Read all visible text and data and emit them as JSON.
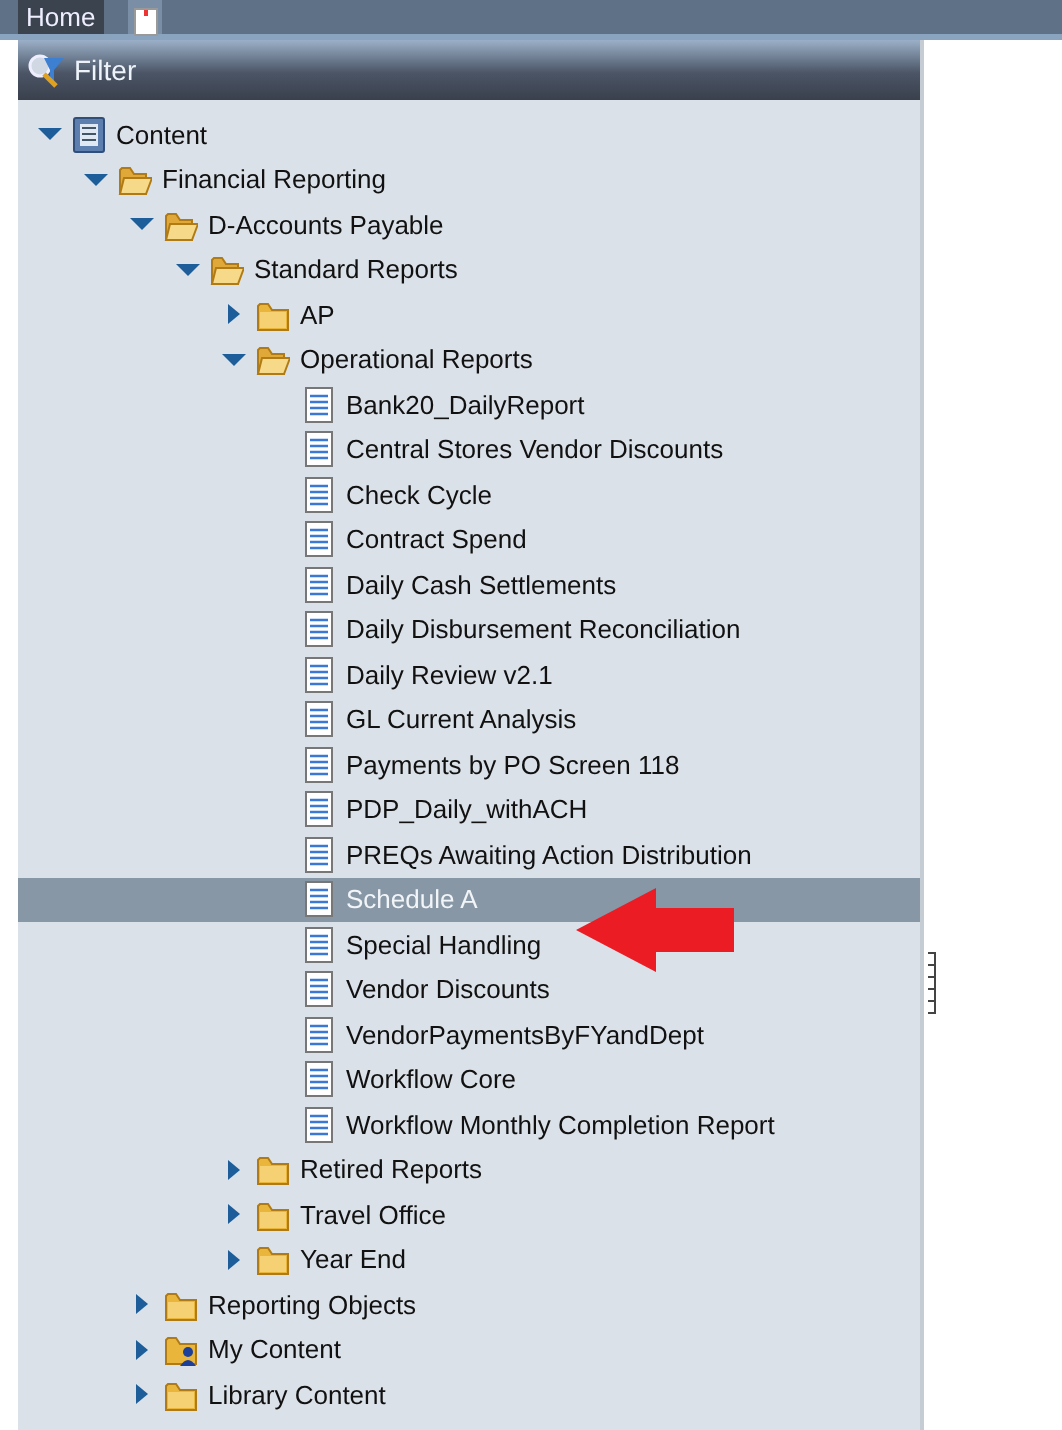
{
  "tabs": [
    {
      "label": "Home",
      "kind": "text",
      "selected": true
    },
    {
      "kind": "document",
      "selected": false
    }
  ],
  "panel": {
    "title": "Filter"
  },
  "tree": [
    {
      "label": "Content",
      "kind": "root",
      "expanded": true,
      "selected": false,
      "children": [
        {
          "label": "Financial Reporting",
          "kind": "folder",
          "expanded": true,
          "selected": false,
          "children": [
            {
              "label": "D-Accounts Payable",
              "kind": "folder",
              "expanded": true,
              "selected": false,
              "children": [
                {
                  "label": "Standard Reports",
                  "kind": "folder",
                  "expanded": true,
                  "selected": false,
                  "children": [
                    {
                      "label": "AP",
                      "kind": "folder",
                      "expanded": false,
                      "selected": false
                    },
                    {
                      "label": "Operational Reports",
                      "kind": "folder",
                      "expanded": true,
                      "selected": false,
                      "children": [
                        {
                          "label": "Bank20_DailyReport",
                          "kind": "report",
                          "selected": false
                        },
                        {
                          "label": "Central Stores Vendor Discounts",
                          "kind": "report",
                          "selected": false
                        },
                        {
                          "label": "Check Cycle",
                          "kind": "report",
                          "selected": false
                        },
                        {
                          "label": "Contract Spend",
                          "kind": "report",
                          "selected": false
                        },
                        {
                          "label": "Daily Cash Settlements",
                          "kind": "report",
                          "selected": false
                        },
                        {
                          "label": "Daily Disbursement Reconciliation",
                          "kind": "report",
                          "selected": false
                        },
                        {
                          "label": "Daily Review v2.1",
                          "kind": "report",
                          "selected": false
                        },
                        {
                          "label": "GL Current Analysis",
                          "kind": "report",
                          "selected": false
                        },
                        {
                          "label": "Payments by PO Screen 118",
                          "kind": "report",
                          "selected": false
                        },
                        {
                          "label": "PDP_Daily_withACH",
                          "kind": "report",
                          "selected": false
                        },
                        {
                          "label": "PREQs Awaiting Action Distribution",
                          "kind": "report",
                          "selected": false
                        },
                        {
                          "label": "Schedule A",
                          "kind": "report",
                          "selected": true
                        },
                        {
                          "label": "Special Handling",
                          "kind": "report",
                          "selected": false
                        },
                        {
                          "label": "Vendor Discounts",
                          "kind": "report",
                          "selected": false
                        },
                        {
                          "label": "VendorPaymentsByFYandDept",
                          "kind": "report",
                          "selected": false
                        },
                        {
                          "label": "Workflow Core",
                          "kind": "report",
                          "selected": false
                        },
                        {
                          "label": "Workflow Monthly Completion Report",
                          "kind": "report",
                          "selected": false
                        }
                      ]
                    },
                    {
                      "label": "Retired Reports",
                      "kind": "folder",
                      "expanded": false,
                      "selected": false
                    },
                    {
                      "label": "Travel Office",
                      "kind": "folder",
                      "expanded": false,
                      "selected": false
                    },
                    {
                      "label": "Year End",
                      "kind": "folder",
                      "expanded": false,
                      "selected": false
                    }
                  ]
                }
              ]
            },
            {
              "label": "Reporting Objects",
              "kind": "folder",
              "expanded": false,
              "selected": false
            },
            {
              "label": "My Content",
              "kind": "user-folder",
              "expanded": false,
              "selected": false
            },
            {
              "label": "Library Content",
              "kind": "folder",
              "expanded": false,
              "selected": false
            }
          ]
        }
      ]
    }
  ]
}
